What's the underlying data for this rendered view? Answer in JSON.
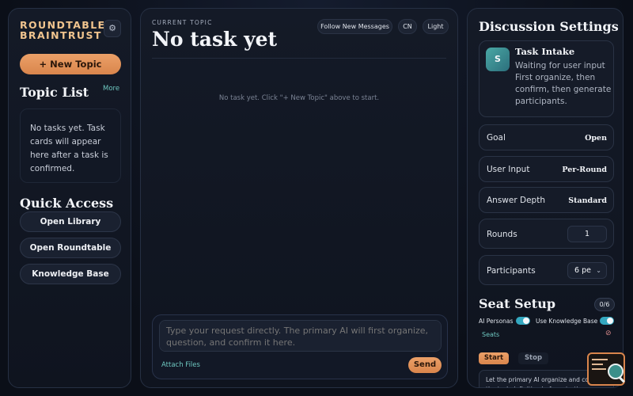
{
  "sidebar": {
    "brand_line1": "ROUNDTABLE",
    "brand_line2": "BRAINTRUST",
    "settings_icon": "gear-icon",
    "new_topic_label": "+ New Topic",
    "topic_list_title": "Topic List",
    "more_label": "More",
    "empty_text": "No tasks yet. Task cards will appear here after a task is confirmed.",
    "quick_access_title": "Quick Access",
    "quick_access": [
      {
        "label": "Open Library"
      },
      {
        "label": "Open Roundtable"
      },
      {
        "label": "Knowledge Base"
      }
    ]
  },
  "main": {
    "current_topic_label": "CURRENT TOPIC",
    "title": "No task yet",
    "follow_label": "Follow New Messages",
    "lang_label": "CN",
    "theme_label": "Light",
    "empty_message": "No task yet. Click \"+ New Topic\" above to start.",
    "composer": {
      "placeholder": "Type your request directly. The primary AI will first organize, question, and confirm it here.",
      "attach_label": "Attach Files",
      "send_label": "Send"
    }
  },
  "settings": {
    "title": "Discussion Settings",
    "intake": {
      "avatar": "S",
      "title": "Task Intake",
      "desc": "Waiting for user input First organize, then confirm, then generate participants."
    },
    "goal": {
      "label": "Goal",
      "value": "Open"
    },
    "user_input": {
      "label": "User Input",
      "value": "Per-Round"
    },
    "answer_depth": {
      "label": "Answer Depth",
      "value": "Standard"
    },
    "rounds": {
      "label": "Rounds",
      "value": "1"
    },
    "participants": {
      "label": "Participants",
      "value": "6 pe"
    },
    "seat_setup": {
      "title": "Seat Setup",
      "count": "0/6",
      "ai_personas_label": "AI Personas",
      "use_kb_label": "Use Knowledge Base",
      "seats_label": "Seats",
      "start_label": "Start",
      "stop_label": "Stop",
      "tip": "Let the primary AI organize and confirm the task definition before starting."
    }
  },
  "colors": {
    "accent": "#d9854c",
    "teal": "#6ec7c0",
    "toggle_on": "#34a8c0"
  }
}
